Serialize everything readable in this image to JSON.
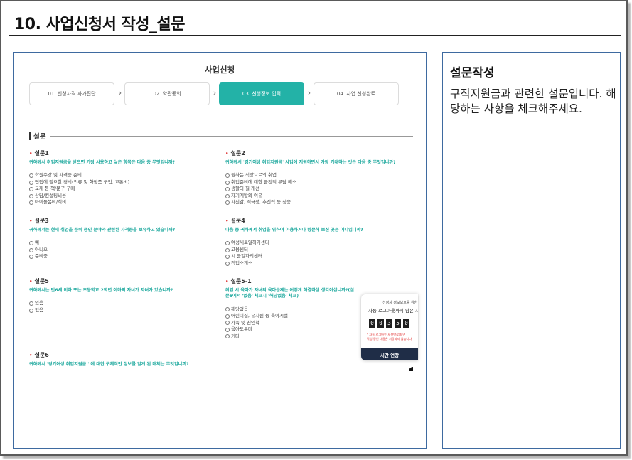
{
  "page": {
    "title": "10. 사업신청서 작성_설문"
  },
  "app": {
    "title": "사업신청",
    "steps": [
      "01. 신청자격 자가진단",
      "02. 약관동의",
      "03. 신청정보 입력",
      "04. 사업 신청완료"
    ],
    "active_step": 2,
    "section_label": "설문"
  },
  "questions": [
    {
      "title": "설문1",
      "text": "귀하께서 취업지원금을 받으면 가장 사용하고 싶은 항목은 다음 중 무엇입니까?",
      "options": [
        "학원수강 및 자격증 준비",
        "면접에 필요한 경비(의류 및 화장품 구입, 교통비)",
        "교재 등 책/문구 구매",
        "상담/컨설팅비용",
        "아이돌봄비/식비"
      ]
    },
    {
      "title": "설문2",
      "text": "귀하께서 '경기여성 취업지원금' 사업에 지원하면서 가장 기대하는 것은 다음 중 무엇입니까?",
      "options": [
        "원하는 직장으로의 취업",
        "취업준비에 대한 금전적 부담 해소",
        "생활의 질 개선",
        "자기계발의 여유",
        "자신감, 적극성, 추진력 등 상승"
      ]
    },
    {
      "title": "설문3",
      "text": "귀하께서는 현재 취업을 준비 중인 분야와 관련된 자격증을 보유하고 있습니까?",
      "options": [
        "예",
        "아니오",
        "준비중"
      ]
    },
    {
      "title": "설문4",
      "text": "다음 중 귀하께서 취업을 위하여 이용하거나 방문해 보신 곳은 어디입니까?",
      "options": [
        "여성새로일하기센터",
        "고용센터",
        "시 군일자리센터",
        "직업소개소"
      ]
    },
    {
      "title": "설문5",
      "text": "귀하께서는 만6세 이하 또는 초등학교 2학년 이하의 자녀가 자녀가 있습니까?",
      "options": [
        "있음",
        "없음"
      ]
    },
    {
      "title": "설문5-1",
      "text": "취업 시 육아가 자녀의 육아문제는 어떻게 해결하실 생각이십니까?(설문5에서 '없음' 체크시 '해당없음' 체크)",
      "options": [
        "해당없음",
        "어린이집, 유치원 등 육아시설",
        "가족 및 친인척",
        "육아도우미",
        "기타"
      ]
    },
    {
      "title": "설문6",
      "text": "귀하께서 '경기여성 취업지원금 ' 에 대한 구체적인 정보를 알게 된 매체는 무엇입니까?",
      "options": []
    }
  ],
  "session_popup": {
    "line1": "신청자 정보보호를 위한",
    "line2": "자동 로그아웃까지 남은 시",
    "digits": [
      "0",
      "0",
      "3",
      "5",
      "0"
    ],
    "warning1": "* 자동 로그아웃(세션만료)되면",
    "warning2": "작성 중인 내용은 저장되지 않습니다",
    "button": "시간 연장"
  },
  "sidebar": {
    "title": "설문작성",
    "description": "구직지원금과 관련한 설문입니다. 해당하는 사항을 체크해주세요."
  },
  "colors": {
    "accent": "#23b2a7",
    "frame": "#3e6aa0",
    "popup_button": "#1f2d47",
    "required_dot": "#e03a3a"
  }
}
